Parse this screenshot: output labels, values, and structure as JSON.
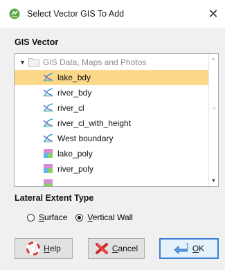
{
  "window": {
    "title": "Select Vector GIS To Add",
    "close_glyph": "✕"
  },
  "gis_section": {
    "label": "GIS Vector"
  },
  "tree": {
    "root": {
      "label": "GIS Data, Maps and Photos",
      "expander": "▼"
    },
    "items": [
      {
        "label": "lake_bdy",
        "icon": "vector-line-icon",
        "selected": true
      },
      {
        "label": "river_bdy",
        "icon": "vector-line-icon",
        "selected": false
      },
      {
        "label": "river_cl",
        "icon": "vector-line-icon",
        "selected": false
      },
      {
        "label": "river_cl_with_height",
        "icon": "vector-line-icon",
        "selected": false
      },
      {
        "label": "West boundary",
        "icon": "vector-line-icon",
        "selected": false
      },
      {
        "label": "lake_poly",
        "icon": "vector-polygon-icon",
        "selected": false
      },
      {
        "label": "river_poly",
        "icon": "vector-polygon-icon",
        "selected": false
      }
    ],
    "scrollbar": {
      "up": "▲",
      "down": "▼",
      "thumb": "≡"
    }
  },
  "lateral_section": {
    "label": "Lateral Extent Type",
    "options": [
      {
        "mnemonic": "S",
        "rest": "urface",
        "checked": false
      },
      {
        "mnemonic": "V",
        "rest": "ertical Wall",
        "checked": true
      }
    ]
  },
  "buttons": {
    "help": {
      "mnemonic": "H",
      "rest": "elp"
    },
    "cancel": {
      "mnemonic": "C",
      "rest": "ancel"
    },
    "ok": {
      "mnemonic": "O",
      "rest": "K"
    }
  },
  "colors": {
    "selection": "#fcd98a",
    "accent": "#3c7fd2"
  }
}
